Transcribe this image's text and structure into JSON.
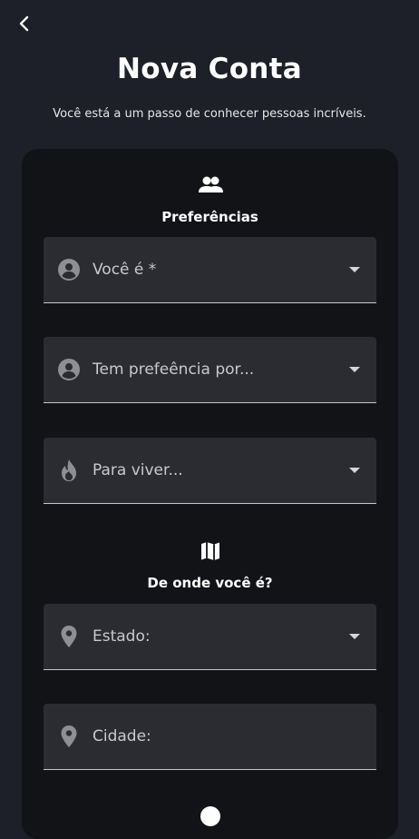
{
  "header": {
    "back_icon": "chevron-left-icon",
    "title": "Nova Conta",
    "subtitle": "Você está a um passo de conhecer pessoas incríveis."
  },
  "sections": {
    "preferences": {
      "icon": "people-icon",
      "title": "Preferências",
      "fields": [
        {
          "icon": "account-circle-icon",
          "label": "Você é *",
          "has_dropdown": true
        },
        {
          "icon": "account-circle-icon",
          "label": "Tem prefeência por...",
          "has_dropdown": true
        },
        {
          "icon": "flame-icon",
          "label": "Para viver...",
          "has_dropdown": true
        }
      ]
    },
    "origin": {
      "icon": "map-icon",
      "title": "De onde você é?",
      "fields": [
        {
          "icon": "location-pin-icon",
          "label": "Estado:",
          "has_dropdown": true
        },
        {
          "icon": "location-pin-icon",
          "label": "Cidade:",
          "has_dropdown": false
        }
      ]
    }
  },
  "colors": {
    "background": "#1d2028",
    "card": "#111317",
    "field": "#2a2c31",
    "text": "#ffffff",
    "muted": "#c9c9cc"
  }
}
